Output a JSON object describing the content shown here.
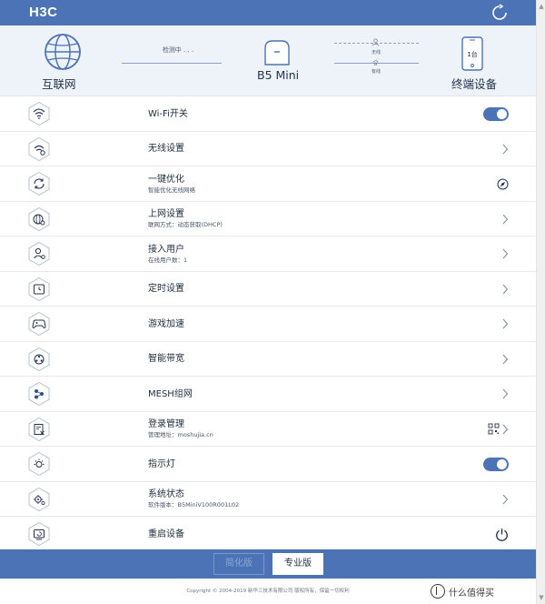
{
  "header": {
    "logo": "H3C",
    "refresh_icon": "refresh-icon",
    "bar_color": "#4c73b6"
  },
  "network": {
    "internet_label": "互联网",
    "checking_text": "检测中 . . .",
    "router_label": "B5 Mini",
    "wireless_text": "无线",
    "wired_text": "有线",
    "device_count": "1台",
    "devices_label": "终端设备"
  },
  "menu": [
    {
      "title": "Wi-Fi开关",
      "sub": "",
      "icon": "wifi-icon",
      "control": "toggle",
      "on": true
    },
    {
      "title": "无线设置",
      "sub": "",
      "icon": "wifi-settings-icon",
      "control": "chevron"
    },
    {
      "title": "一键优化",
      "sub": "智能优化无线网络",
      "icon": "optimize-icon",
      "control": "compass"
    },
    {
      "title": "上网设置",
      "sub": "联网方式：动态获取(DHCP)",
      "icon": "globe-settings-icon",
      "control": "chevron"
    },
    {
      "title": "接入用户",
      "sub": "在线用户数：1",
      "icon": "users-icon",
      "control": "chevron"
    },
    {
      "title": "定时设置",
      "sub": "",
      "icon": "timer-icon",
      "control": "chevron"
    },
    {
      "title": "游戏加速",
      "sub": "",
      "icon": "gamepad-icon",
      "control": "chevron"
    },
    {
      "title": "智能带宽",
      "sub": "",
      "icon": "bandwidth-icon",
      "control": "chevron"
    },
    {
      "title": "MESH组网",
      "sub": "",
      "icon": "mesh-icon",
      "control": "chevron"
    },
    {
      "title": "登录管理",
      "sub": "管理地址：moshujia.cn",
      "icon": "login-manage-icon",
      "control": "qr-chevron"
    },
    {
      "title": "指示灯",
      "sub": "",
      "icon": "indicator-light-icon",
      "control": "toggle",
      "on": true
    },
    {
      "title": "系统状态",
      "sub": "软件版本：B5MiniV100R001L02",
      "icon": "system-status-icon",
      "control": "chevron"
    },
    {
      "title": "重启设备",
      "sub": "",
      "icon": "restart-icon",
      "control": "power"
    }
  ],
  "bottom": {
    "simple_label": "简化版",
    "pro_label": "专业版"
  },
  "footer": {
    "copyright": "Copyright © 2004-2019 新华三技术有限公司 版权所有，保留一切权利",
    "watermark": "什么值得买"
  }
}
